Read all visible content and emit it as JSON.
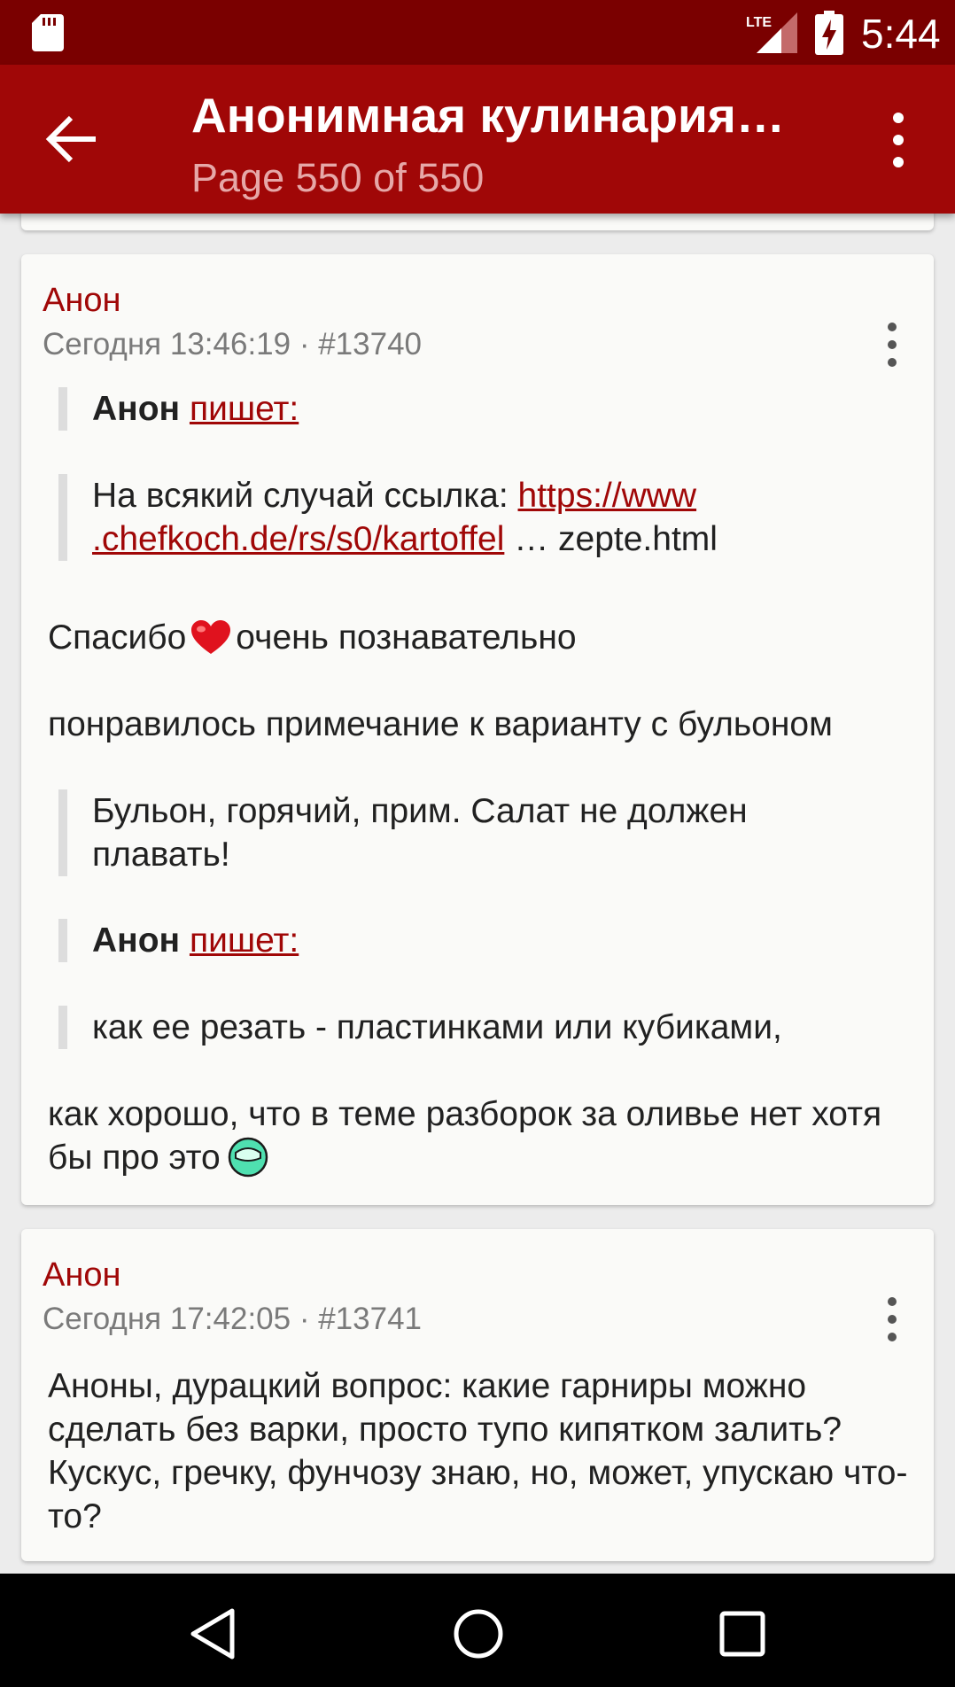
{
  "status_bar": {
    "time": "5:44",
    "network": "LTE"
  },
  "app_bar": {
    "title": "Анонимная кулинария…",
    "subtitle": "Page 550 of 550"
  },
  "posts": [
    {
      "author": "Анон",
      "meta": "Сегодня 13:46:19 · #13740",
      "quote1_author": "Анон",
      "quote1_link": "пишет:",
      "quote2_prefix": "На всякий случай ссылка: ",
      "quote2_link_line1": "https://www",
      "quote2_link_line2": ".chefkoch.de/rs/s0/kartoffel",
      "quote2_suffix": " … zepte.html",
      "p1_before": "Спасибо",
      "p1_after": "очень познавательно",
      "p2": "понравилось примечание к варианту с бульоном",
      "quote3": "Бульон, горячий, прим. Салат не должен плавать!",
      "quote4_author": "Анон",
      "quote4_link": "пишет:",
      "quote5": "как ее резать - пластинками или кубиками,",
      "p3": "как хорошо, что в теме разборок за оливье нет хотя бы про это"
    },
    {
      "author": "Анон",
      "meta": "Сегодня 17:42:05 · #13741",
      "body": "Аноны, дурацкий вопрос: какие гарниры можно сделать без варки, просто тупо кипятком залить? Кускус, гречку, фунчозу знаю, но, может, упускаю что-то?"
    }
  ],
  "icons": {
    "back": "arrow-left-icon",
    "overflow": "more-vert-icon",
    "heart": "heart-emoji",
    "smile": "smile-emoji"
  },
  "colors": {
    "primary": "#a00707",
    "status_bar": "#7a0000",
    "link": "#a00707"
  }
}
